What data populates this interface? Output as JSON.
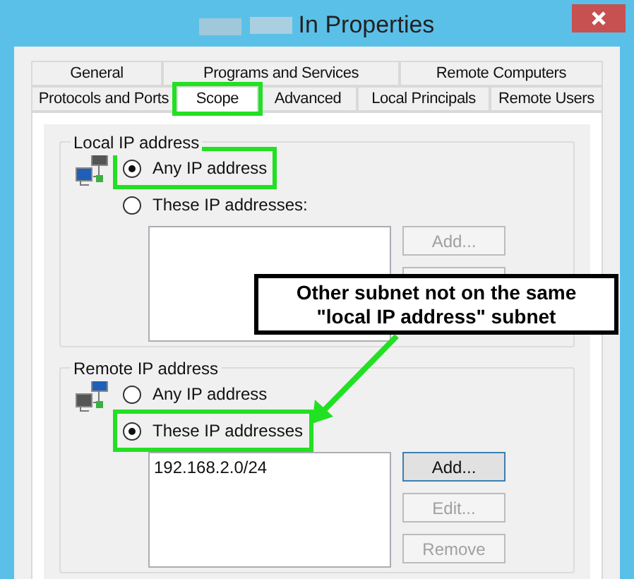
{
  "window": {
    "title": "In Properties"
  },
  "tab_rows": [
    [
      {
        "label": "General",
        "selected": false
      },
      {
        "label": "Programs and Services",
        "selected": false
      },
      {
        "label": "Remote Computers",
        "selected": false
      }
    ],
    [
      {
        "label": "Protocols and Ports",
        "selected": false
      },
      {
        "label": "Scope",
        "selected": true,
        "highlighted": true
      },
      {
        "label": "Advanced",
        "selected": false
      },
      {
        "label": "Local Principals",
        "selected": false
      },
      {
        "label": "Remote Users",
        "selected": false
      }
    ]
  ],
  "groups": [
    {
      "title": "Local IP address",
      "options": [
        {
          "label": "Any IP address",
          "selected": true,
          "highlighted": true
        },
        {
          "label": "These IP addresses:",
          "selected": false,
          "highlighted": false
        }
      ],
      "buttons": [
        {
          "label": "Add...",
          "disabled": true
        },
        {
          "kind": "covered"
        }
      ]
    },
    {
      "title": "Remote IP address",
      "options": [
        {
          "label": "Any IP address",
          "selected": false,
          "highlighted": false
        },
        {
          "label": "These IP addresses",
          "selected": true,
          "highlighted": true
        }
      ],
      "addresses": [
        "192.168.2.0/24"
      ],
      "buttons": [
        {
          "label": "Add...",
          "disabled": false,
          "focused": true
        },
        {
          "label": "Edit...",
          "disabled": true
        },
        {
          "label": "Remove",
          "disabled": true
        }
      ]
    }
  ],
  "callout": {
    "lines": [
      "Other subnet not on the same",
      "\"local IP address\" subnet"
    ]
  }
}
